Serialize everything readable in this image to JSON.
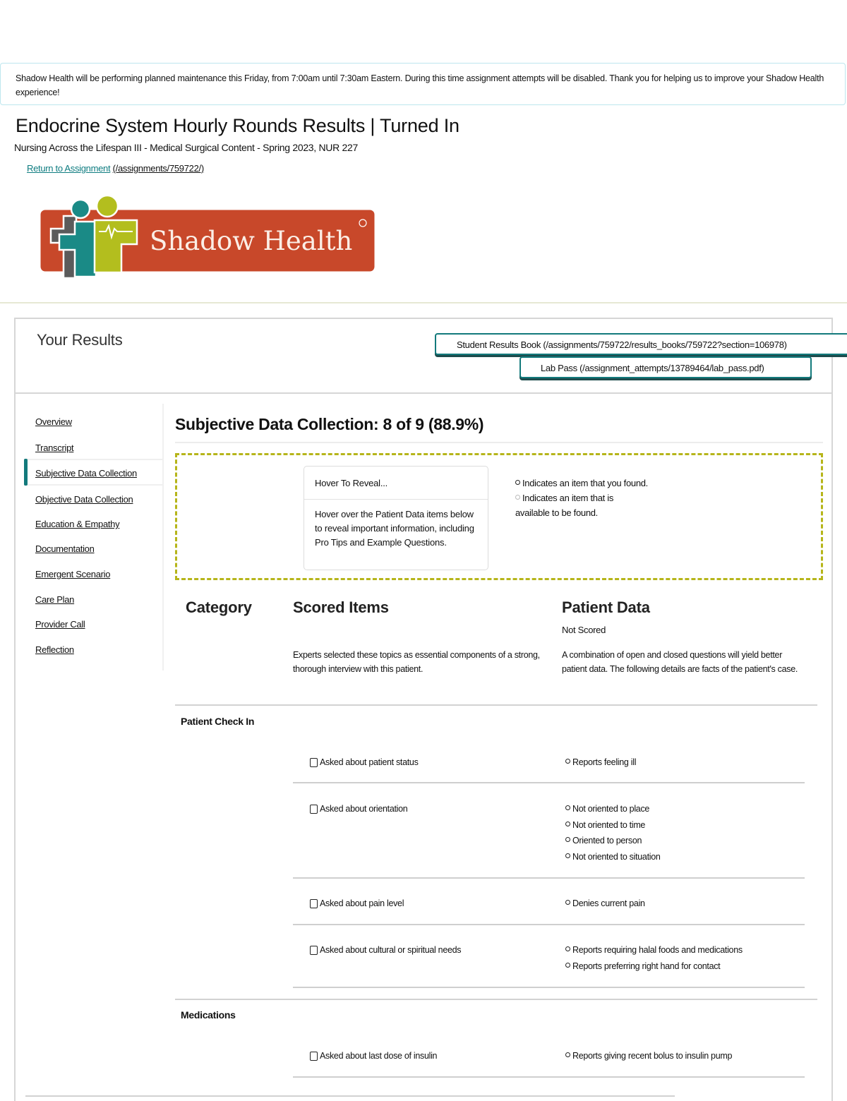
{
  "notice": {
    "text": "Shadow Health will be performing planned maintenance this Friday, from 7:00am until 7:30am Eastern. During this time assignment attempts will be disabled. Thank you for helping us to improve your Shadow Health experience!"
  },
  "header": {
    "title": "Endocrine System Hourly Rounds Results | Turned In",
    "course": "Nursing Across the Lifespan III - Medical Surgical Content - Spring 2023, NUR 227",
    "return_link": "Return to Assignment",
    "return_path": "(/assignments/759722/)"
  },
  "logo": {
    "brand": "Shadow Health",
    "colors": {
      "orange": "#c8482a",
      "lime": "#b3be1e",
      "teal": "#1a8a86",
      "gray": "#5b5b5b"
    }
  },
  "results": {
    "heading": "Your Results",
    "buttons": {
      "results_book": "Student Results Book (/assignments/759722/results_books/759722?section=106978)",
      "lab_pass": "Lab Pass (/assignment_attempts/13789464/lab_pass.pdf)"
    }
  },
  "sidebar": {
    "active_index": 2,
    "accent": "#137a7c",
    "items": [
      {
        "label": "Overview"
      },
      {
        "label": "Transcript"
      },
      {
        "label": "Subjective Data Collection"
      },
      {
        "label": "Objective Data Collection"
      },
      {
        "label": "Education & Empathy"
      },
      {
        "label": "Documentation"
      },
      {
        "label": "Emergent Scenario"
      },
      {
        "label": "Care Plan"
      },
      {
        "label": "Provider Call"
      },
      {
        "label": "Reflection"
      }
    ]
  },
  "main": {
    "title": "Subjective Data Collection: 8 of 9 (88.9%)",
    "score": {
      "earned": 8,
      "total": 9,
      "percent": 88.9
    },
    "legend": {
      "hover_title": "Hover To Reveal...",
      "hover_body": "Hover over the Patient Data items below to reveal important information, including Pro Tips and Example Questions.",
      "found_text": "Indicates an item that you found.",
      "available_text": "Indicates an item that is available to be found."
    },
    "columns": {
      "category": "Category",
      "scored_items": "Scored Items",
      "patient_data": "Patient Data",
      "not_scored": "Not Scored",
      "scored_desc": "Experts selected these topics as essential components of a strong, thorough interview with this patient.",
      "patient_desc": "A combination of open and closed questions will yield better patient data. The following details are facts of the patient's case."
    },
    "categories": [
      {
        "name": "Patient Check In",
        "rows": [
          {
            "item": "Asked about patient status",
            "checked": false,
            "data": [
              "Reports feeling ill"
            ]
          },
          {
            "item": "Asked about orientation",
            "checked": false,
            "data": [
              "Not oriented to place",
              "Not oriented to time",
              "Oriented to person",
              "Not oriented to situation"
            ]
          },
          {
            "item": "Asked about pain level",
            "checked": false,
            "data": [
              "Denies current pain"
            ]
          },
          {
            "item": "Asked about cultural or spiritual needs",
            "checked": false,
            "data": [
              "Reports requiring halal foods and medications",
              "Reports preferring right hand for contact"
            ]
          }
        ]
      },
      {
        "name": "Medications",
        "rows": [
          {
            "item": "Asked about last dose of insulin",
            "checked": false,
            "data": [
              "Reports giving recent bolus to insulin pump"
            ]
          }
        ]
      }
    ]
  }
}
